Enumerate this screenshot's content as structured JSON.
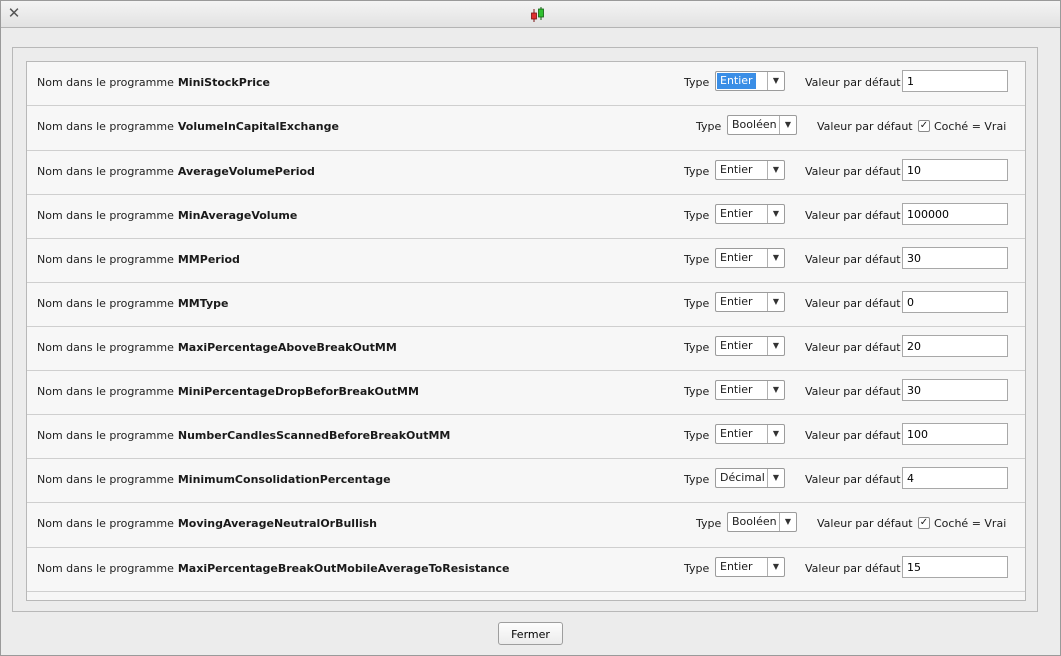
{
  "window": {
    "close_glyph": "✕",
    "icon": "candlestick-chart-icon"
  },
  "common": {
    "name_prefix": "Nom dans le programme",
    "type_label": "Type",
    "default_label": "Valeur par défaut",
    "checkbox_label": "Coché = Vrai",
    "check_glyph": "✓"
  },
  "parameters": [
    {
      "name": "MiniStockPrice",
      "type": "Entier",
      "default": "1",
      "selected": true
    },
    {
      "name": "VolumeInCapitalExchange",
      "type": "Booléen",
      "checked": true
    },
    {
      "name": "AverageVolumePeriod",
      "type": "Entier",
      "default": "10"
    },
    {
      "name": "MinAverageVolume",
      "type": "Entier",
      "default": "100000"
    },
    {
      "name": "MMPeriod",
      "type": "Entier",
      "default": "30"
    },
    {
      "name": "MMType",
      "type": "Entier",
      "default": "0"
    },
    {
      "name": "MaxiPercentageAboveBreakOutMM",
      "type": "Entier",
      "default": "20"
    },
    {
      "name": "MiniPercentageDropBeforBreakOutMM",
      "type": "Entier",
      "default": "30"
    },
    {
      "name": "NumberCandlesScannedBeforeBreakOutMM",
      "type": "Entier",
      "default": "100"
    },
    {
      "name": "MinimumConsolidationPercentage",
      "type": "Décimal",
      "default": "4"
    },
    {
      "name": "MovingAverageNeutralOrBullish",
      "type": "Booléen",
      "checked": true
    },
    {
      "name": "MaxiPercentageBreakOutMobileAverageToResistance",
      "type": "Entier",
      "default": "15"
    }
  ],
  "footer": {
    "close_button": "Fermer"
  },
  "colors": {
    "selection": "#3a8ee6",
    "checkbox_accent": "#222222"
  }
}
